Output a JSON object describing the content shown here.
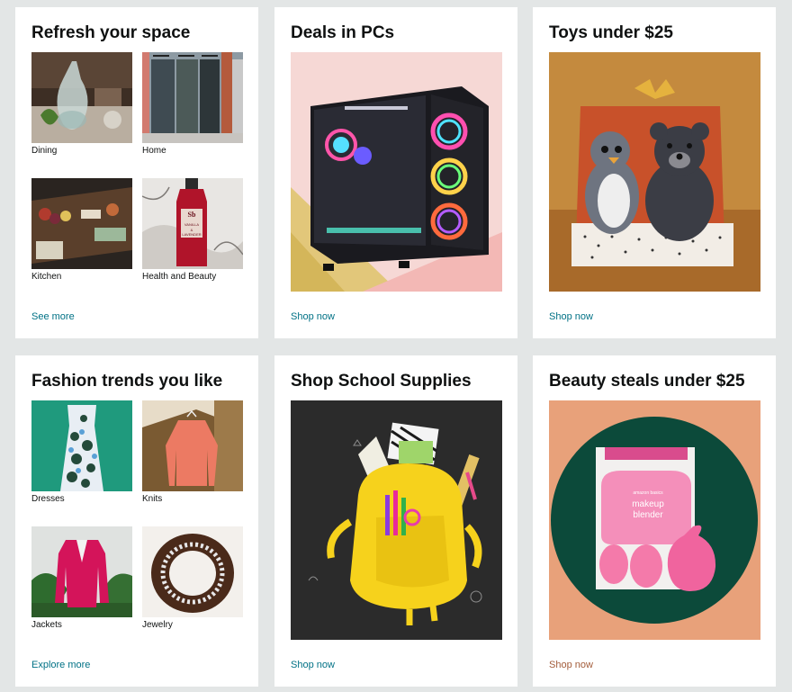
{
  "cards": [
    {
      "title": "Refresh your space",
      "link": "See more",
      "items": [
        {
          "label": "Dining",
          "icon": "dining-image"
        },
        {
          "label": "Home",
          "icon": "home-image"
        },
        {
          "label": "Kitchen",
          "icon": "kitchen-image"
        },
        {
          "label": "Health and Beauty",
          "icon": "health-beauty-image"
        }
      ]
    },
    {
      "title": "Deals in PCs",
      "link": "Shop now",
      "hero": "gaming-pc-image"
    },
    {
      "title": "Toys under $25",
      "link": "Shop now",
      "hero": "plush-toys-image"
    },
    {
      "title": "Fashion trends you like",
      "link": "Explore more",
      "items": [
        {
          "label": "Dresses",
          "icon": "dress-image"
        },
        {
          "label": "Knits",
          "icon": "knit-image"
        },
        {
          "label": "Jackets",
          "icon": "jacket-image"
        },
        {
          "label": "Jewelry",
          "icon": "jewelry-image"
        }
      ]
    },
    {
      "title": "Shop School Supplies",
      "link": "Shop now",
      "hero": "backpack-image"
    },
    {
      "title": "Beauty steals under $25",
      "link": "Shop now",
      "hero": "makeup-blender-image",
      "product_text": {
        "brand": "amazon basics",
        "line1": "makeup",
        "line2": "blender"
      }
    }
  ],
  "product_bottle_text": {
    "logo": "Sb",
    "line1": "VANILLA",
    "line2": "& LAVENDER"
  },
  "colors": {
    "background": "#e3e6e6",
    "link": "#007185",
    "link_alt": "#a35c3a",
    "title": "#0f1111"
  }
}
